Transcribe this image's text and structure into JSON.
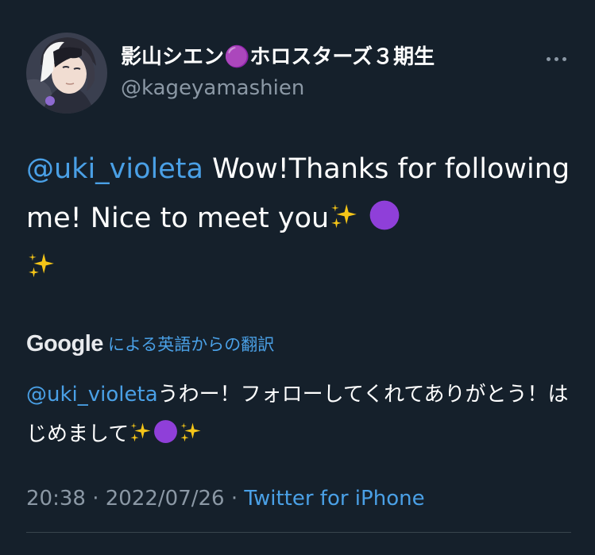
{
  "tweet": {
    "display_name": "影山シエン🟣ホロスターズ３期生",
    "handle": "@kageyamashien",
    "body": {
      "mention": "@uki_violeta",
      "text": " Wow!Thanks for following me! Nice to meet you",
      "emojis": [
        "sparkles-icon",
        "purple-circle-icon",
        "sparkles-icon"
      ]
    },
    "translation": {
      "provider": "Google",
      "link_label": "による英語からの翻訳",
      "mention": "@uki_violeta",
      "text": "うわー！フォローしてくれてありがとう！はじめまして",
      "emojis": [
        "sparkles-icon",
        "purple-circle-icon",
        "sparkles-icon"
      ]
    },
    "time": "20:38",
    "separator1": " · ",
    "date": "2022/07/26",
    "separator2": " · ",
    "source": "Twitter for iPhone"
  },
  "colors": {
    "background": "#15202b",
    "link": "#4aa0e6",
    "secondary_text": "#8b98a5",
    "sparkle": "#f5c518",
    "purple_circle": "#8f3fd9"
  }
}
